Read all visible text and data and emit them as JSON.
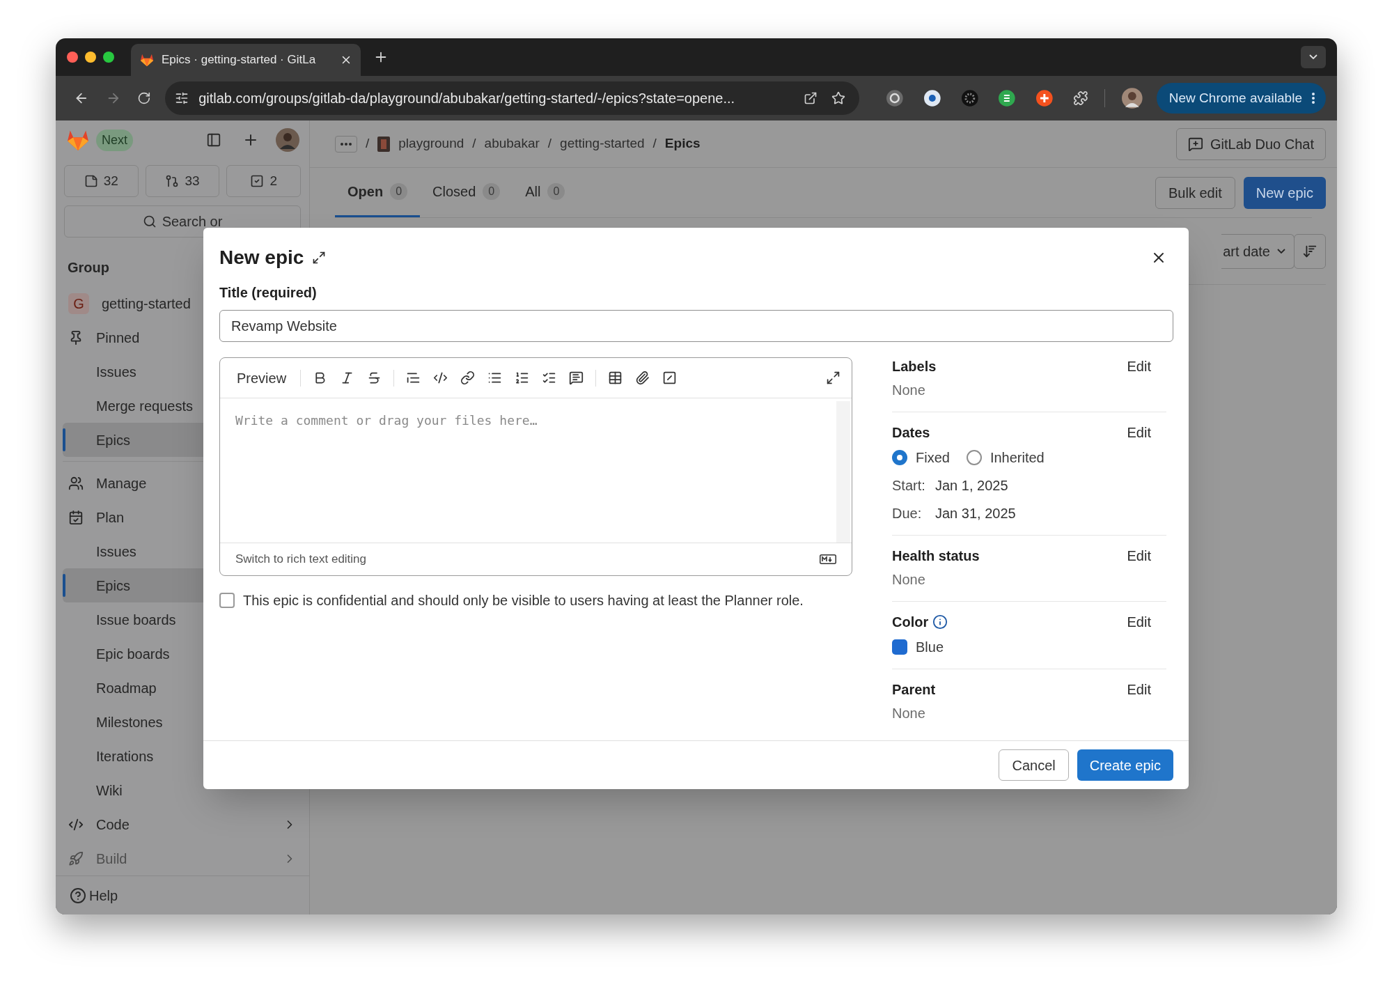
{
  "browser": {
    "tab_title": "Epics · getting-started · GitLa",
    "url": "gitlab.com/groups/gitlab-da/playground/abubakar/getting-started/-/epics?state=opene...",
    "update_button": "New Chrome available"
  },
  "sidebar": {
    "badge": "Next",
    "counts": [
      {
        "kind": "issues",
        "count": "32"
      },
      {
        "kind": "merge_requests",
        "count": "33"
      },
      {
        "kind": "todos",
        "count": "2"
      }
    ],
    "search": {
      "placeholder": "Search or"
    },
    "heading": "Group",
    "items": [
      {
        "kind": "group",
        "label": "getting-started",
        "avatar_letter": "G",
        "selected": false
      },
      {
        "kind": "pinned",
        "label": "Pinned",
        "selected": false,
        "children": [
          {
            "label": "Issues",
            "selected": false
          },
          {
            "label": "Merge requests",
            "selected": false
          },
          {
            "label": "Epics",
            "selected": true
          }
        ]
      },
      {
        "kind": "manage",
        "label": "Manage",
        "selected": false
      },
      {
        "kind": "plan",
        "label": "Plan",
        "selected": false,
        "children": [
          {
            "label": "Issues",
            "selected": false
          },
          {
            "label": "Epics",
            "selected": true
          },
          {
            "label": "Issue boards",
            "selected": false
          },
          {
            "label": "Epic boards",
            "selected": false
          },
          {
            "label": "Roadmap",
            "selected": false
          },
          {
            "label": "Milestones",
            "selected": false
          },
          {
            "label": "Iterations",
            "selected": false
          },
          {
            "label": "Wiki",
            "selected": false
          }
        ]
      },
      {
        "kind": "code",
        "label": "Code",
        "selected": false,
        "expanded": false
      },
      {
        "kind": "build",
        "label": "Build",
        "selected": false,
        "expanded": false
      }
    ],
    "help": "Help"
  },
  "main": {
    "breadcrumb": [
      {
        "separator": "/",
        "label": "playground"
      },
      {
        "separator": "/",
        "label": "abubakar"
      },
      {
        "separator": "/",
        "label": "getting-started"
      },
      {
        "separator": "/",
        "label": "Epics"
      }
    ],
    "duo_chat": "GitLab Duo Chat",
    "tabs": [
      {
        "label": "Open",
        "count": "0",
        "selected": true
      },
      {
        "label": "Closed",
        "count": "0",
        "selected": false
      },
      {
        "label": "All",
        "count": "0",
        "selected": false
      }
    ],
    "buttons": [
      "Bulk edit",
      "New epic"
    ],
    "sort": "art date"
  },
  "modal": {
    "title": "New epic",
    "title_label": "Title (required)",
    "title_value": "Revamp Website",
    "editor": {
      "preview": "Preview",
      "placeholder": "Write a comment or drag your files here…",
      "switch": "Switch to rich text editing"
    },
    "confidential": {
      "label": "This epic is confidential and should only be visible to users having at least the Planner role.",
      "checked": false
    },
    "fields": [
      {
        "kind": "text",
        "label": "Labels",
        "edit": "Edit",
        "value": "None"
      },
      {
        "kind": "dates",
        "label": "Dates",
        "edit": "Edit",
        "options": [
          {
            "label": "Fixed",
            "selected": true
          },
          {
            "label": "Inherited",
            "selected": false
          }
        ],
        "rows": [
          {
            "label": "Start:",
            "value": "Jan 1, 2025"
          },
          {
            "label": "Due:",
            "value": "Jan 31, 2025"
          }
        ]
      },
      {
        "kind": "text",
        "label": "Health status",
        "edit": "Edit",
        "value": "None"
      },
      {
        "kind": "color",
        "label": "Color",
        "edit": "Edit",
        "value": "Blue",
        "color": "#1f6bd0"
      },
      {
        "kind": "text",
        "label": "Parent",
        "edit": "Edit",
        "value": "None"
      }
    ],
    "buttons": [
      "Cancel",
      "Create epic"
    ]
  }
}
